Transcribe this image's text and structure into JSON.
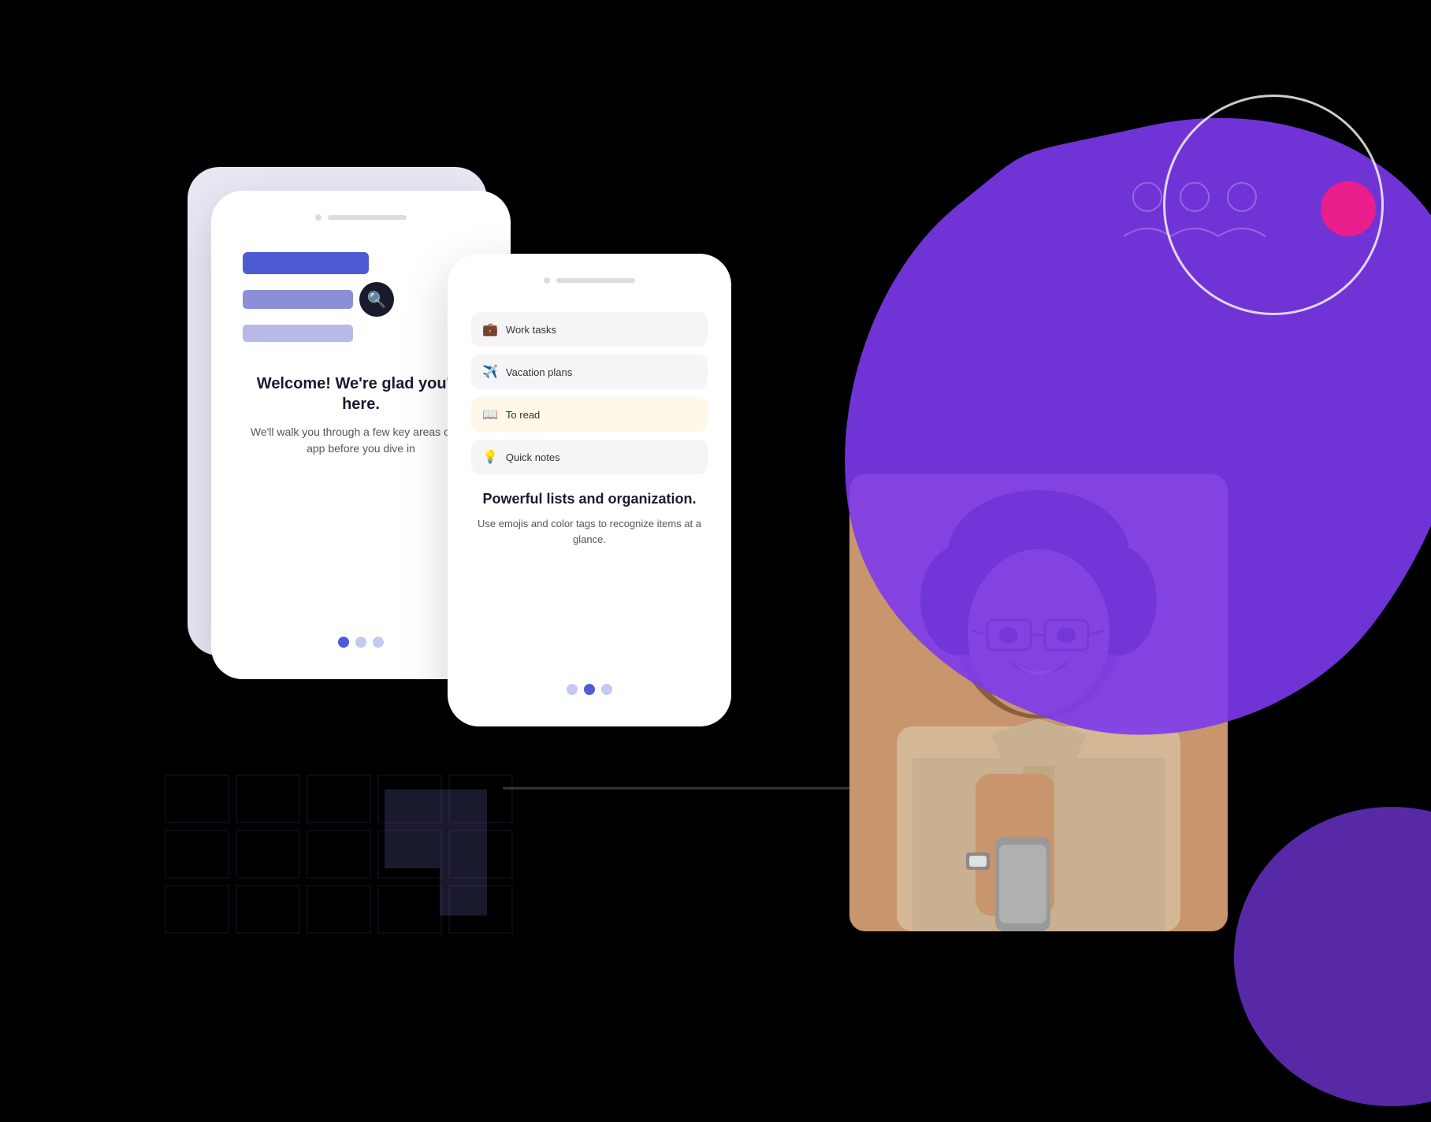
{
  "scene": {
    "background_color": "#000000"
  },
  "left_phone": {
    "welcome_title": "Welcome!\nWe're glad you're here.",
    "welcome_subtitle": "We'll walk you through a\nfew key areas of the app\nbefore you dive in",
    "dots": [
      "active",
      "inactive",
      "inactive"
    ]
  },
  "right_phone": {
    "list_items": [
      {
        "emoji": "💼",
        "label": "Work tasks",
        "active": false
      },
      {
        "emoji": "✈️",
        "label": "Vacation plans",
        "active": false
      },
      {
        "emoji": "📖",
        "label": "To read",
        "active": true
      },
      {
        "emoji": "💡",
        "label": "Quick notes",
        "active": false
      }
    ],
    "feature_title": "Powerful lists and\norganization.",
    "feature_subtitle": "Use emojis and color tags\nto recognize items at a\nglance.",
    "dots": [
      "inactive",
      "active",
      "inactive"
    ]
  }
}
